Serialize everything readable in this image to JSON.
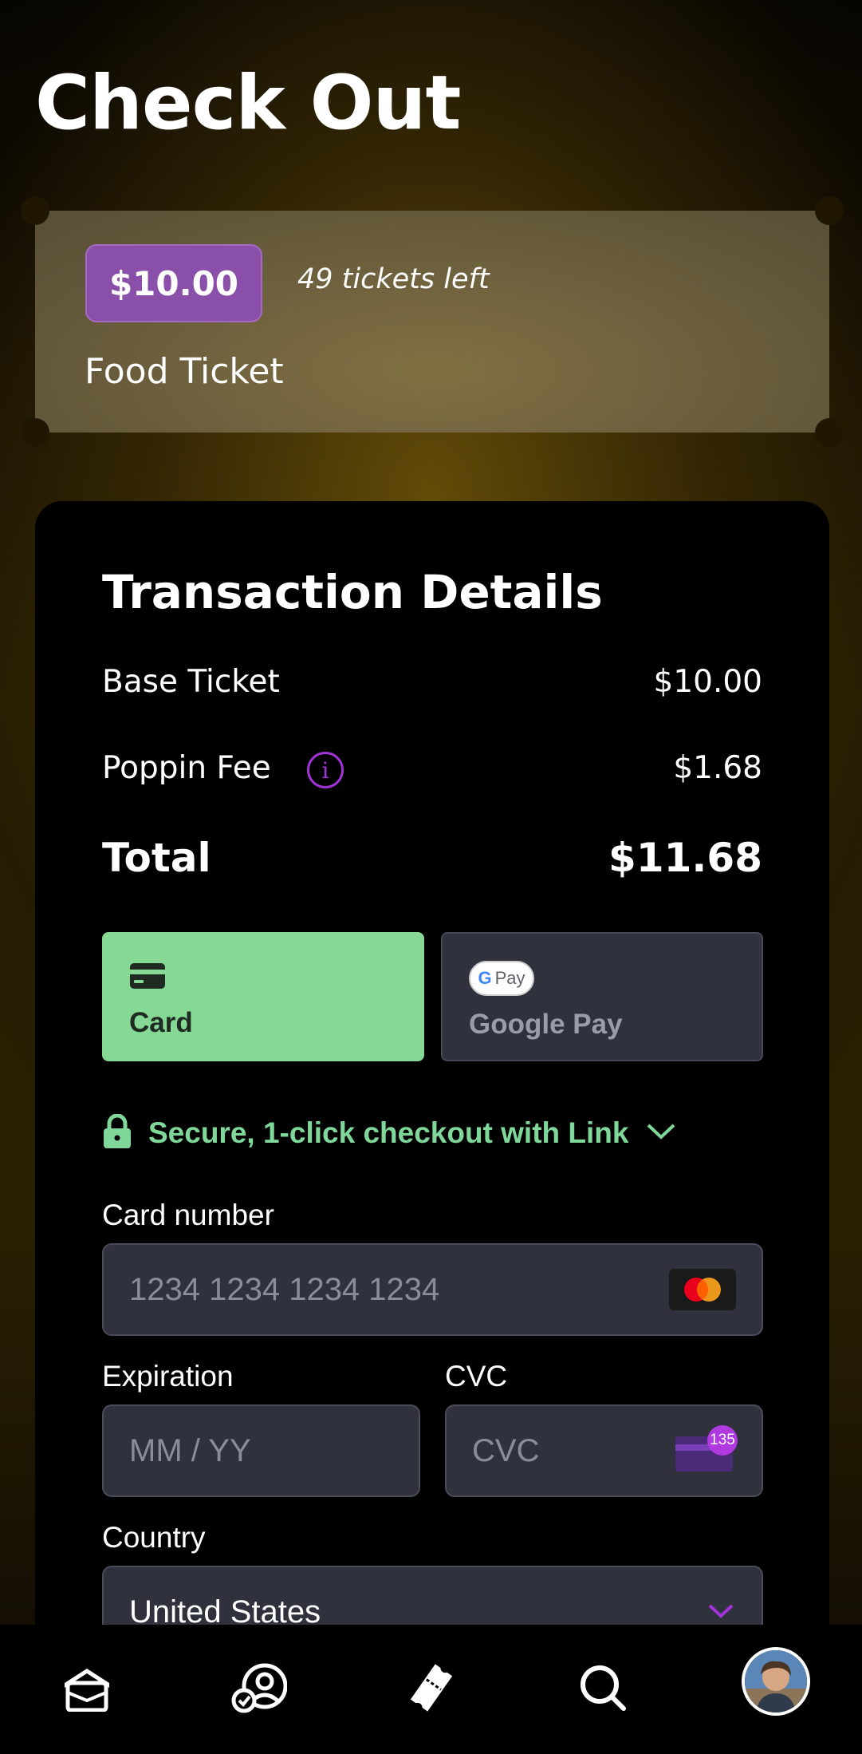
{
  "page": {
    "title": "Check Out"
  },
  "ticket": {
    "price": "$10.00",
    "tickets_left": "49 tickets left",
    "name": "Food Ticket"
  },
  "transaction": {
    "title": "Transaction Details",
    "base_label": "Base Ticket",
    "base_value": "$10.00",
    "fee_label": "Poppin Fee",
    "fee_value": "$1.68",
    "total_label": "Total",
    "total_value": "$11.68"
  },
  "payment": {
    "card_label": "Card",
    "gpay_badge": "Pay",
    "gpay_label": "Google Pay",
    "secure_text": "Secure, 1-click checkout with Link",
    "card_number_label": "Card number",
    "card_number_placeholder": "1234 1234 1234 1234",
    "expiration_label": "Expiration",
    "expiration_placeholder": "MM / YY",
    "cvc_label": "CVC",
    "cvc_placeholder": "CVC",
    "cvc_badge": "135",
    "country_label": "Country",
    "country_value": "United States"
  },
  "colors": {
    "accent_green": "#86d895",
    "link_green": "#7fd89a",
    "purple": "#a033d6",
    "badge_purple": "#8a4fa8"
  },
  "nav": {
    "items": [
      "home-icon",
      "friends-icon",
      "ticket-icon",
      "search-icon",
      "profile-avatar"
    ]
  }
}
